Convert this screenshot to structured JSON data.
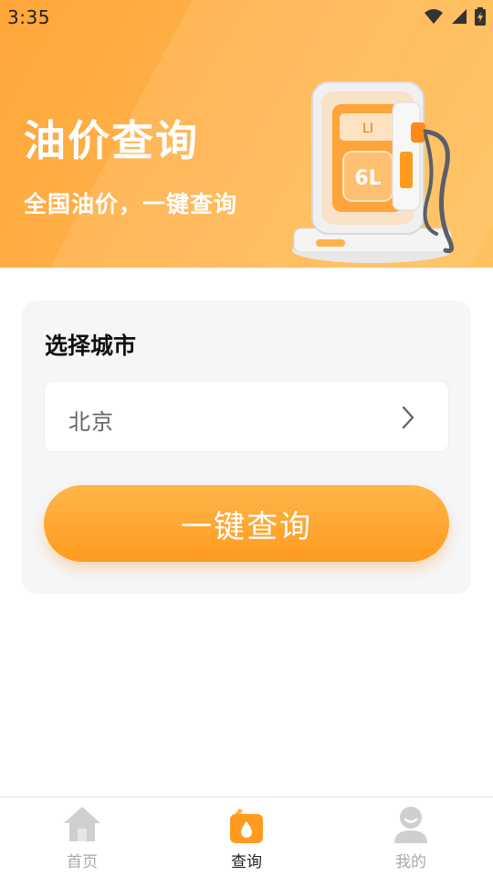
{
  "status_bar": {
    "time": "3:35",
    "icons": [
      "wifi-icon",
      "signal-icon",
      "battery-charging-icon"
    ]
  },
  "hero": {
    "title": "油价查询",
    "subtitle": "全国油价，一键查询",
    "pump_display": "6L"
  },
  "city_card": {
    "title": "选择城市",
    "city_value": "北京",
    "query_button_label": "一键查询"
  },
  "tabbar": {
    "items": [
      {
        "label": "首页",
        "icon": "home-icon",
        "active": false
      },
      {
        "label": "查询",
        "icon": "oil-can-icon",
        "active": true
      },
      {
        "label": "我的",
        "icon": "profile-icon",
        "active": false
      }
    ]
  },
  "colors": {
    "accent": "#ff9a1f",
    "hero_bg": "#ffb24a",
    "card_bg": "#f5f6f8",
    "tab_inactive": "#a8a8a8"
  }
}
